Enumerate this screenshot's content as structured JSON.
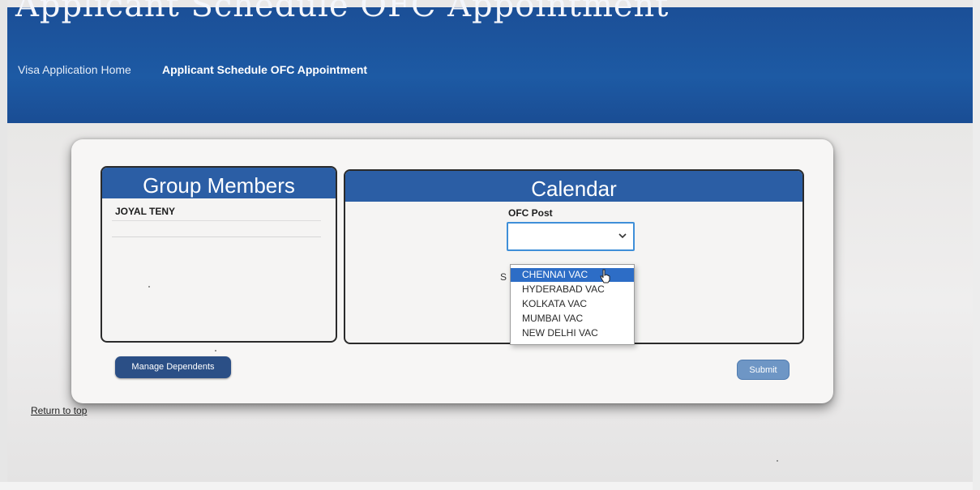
{
  "header": {
    "title": "Applicant Schedule OFC Appointment",
    "nav_home": "Visa Application Home",
    "nav_current": "Applicant Schedule OFC Appointment"
  },
  "group_members": {
    "title": "Group Members",
    "members": [
      "JOYAL TENY"
    ]
  },
  "calendar": {
    "title": "Calendar",
    "ofc_post_label": "OFC Post",
    "hint_partial": "S",
    "options": [
      "CHENNAI VAC",
      "HYDERABAD VAC",
      "KOLKATA VAC",
      "MUMBAI VAC",
      "NEW DELHI VAC"
    ],
    "highlighted_option": "CHENNAI VAC"
  },
  "buttons": {
    "manage_dependents": "Manage Dependents",
    "submit": "Submit"
  },
  "footer": {
    "return_to_top": "Return to top"
  },
  "colors": {
    "header_blue": "#1d5aa4",
    "panel_header_blue": "#2b5ea5",
    "select_focus": "#3f8fd8",
    "option_highlight": "#2d6dc6",
    "manage_button": "#2b4f86",
    "submit_button": "#6e96c5"
  },
  "icons": {
    "select_arrow": "chevron-down-icon",
    "mouse_pointer": "hand-cursor-icon"
  }
}
